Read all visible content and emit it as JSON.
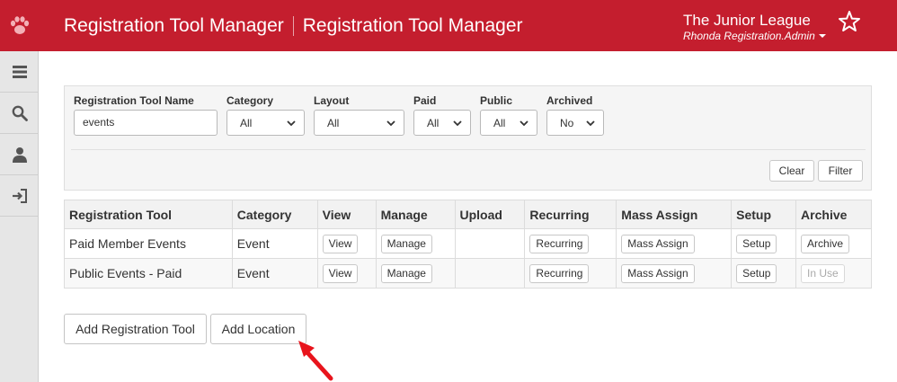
{
  "header": {
    "title_primary": "Registration Tool Manager",
    "title_secondary": "Registration Tool Manager",
    "org_name": "The Junior League",
    "user_name": "Rhonda Registration.Admin",
    "brand_color": "#c41e2e"
  },
  "sidebar": {
    "items": [
      {
        "icon": "menu-icon"
      },
      {
        "icon": "search-icon"
      },
      {
        "icon": "user-icon"
      },
      {
        "icon": "sign-in-icon"
      }
    ]
  },
  "filters": {
    "name_label": "Registration Tool Name",
    "name_value": "events",
    "category_label": "Category",
    "category_value": "All",
    "layout_label": "Layout",
    "layout_value": "All",
    "paid_label": "Paid",
    "paid_value": "All",
    "public_label": "Public",
    "public_value": "All",
    "archived_label": "Archived",
    "archived_value": "No",
    "clear_label": "Clear",
    "filter_label": "Filter"
  },
  "table": {
    "headers": [
      "Registration Tool",
      "Category",
      "View",
      "Manage",
      "Upload",
      "Recurring",
      "Mass Assign",
      "Setup",
      "Archive"
    ],
    "rows": [
      {
        "name": "Paid Member Events",
        "category": "Event",
        "view": "View",
        "manage": "Manage",
        "recurring": "Recurring",
        "mass_assign": "Mass Assign",
        "setup": "Setup",
        "archive": "Archive"
      },
      {
        "name": "Public Events - Paid",
        "category": "Event",
        "view": "View",
        "manage": "Manage",
        "recurring": "Recurring",
        "mass_assign": "Mass Assign",
        "setup": "Setup",
        "archive": "In Use"
      }
    ]
  },
  "actions": {
    "add_tool_label": "Add Registration Tool",
    "add_location_label": "Add Location"
  }
}
